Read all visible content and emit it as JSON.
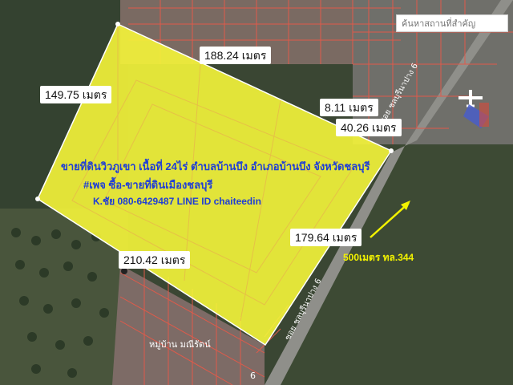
{
  "search": {
    "placeholder": "ค้นหาสถานที่สำคัญ"
  },
  "measurements": {
    "top_edge": "188.24 เมตร",
    "left_edge": "149.75 เมตร",
    "notch": "8.11 เมตร",
    "right_upper": "40.26 เมตร",
    "right_edge": "179.64 เมตร",
    "bottom_edge": "210.42 เมตร"
  },
  "listing": {
    "title": "ขายที่ดินวิวภูเขา เนื้อที่ 24ไร่ ตำบลบ้านบึง อำเภอบ้านบึง จังหวัดชลบุรี",
    "page": "#เพจ ซื้อ-ขายที่ดินเมืองชลบุรี",
    "contact": "K.ชัย 080-6429487 LINE ID chaiteedin"
  },
  "annotation": {
    "distance": "500เมตร ทล.344"
  },
  "map_labels": {
    "road_upper": "ซอย ชลบุรีนาปาง 6",
    "road_lower": "ซอย ชลบุรีนาปาง 6",
    "village": "หมู่บ้าน มณีรัตน์",
    "edge_number": "6"
  },
  "colors": {
    "plot_fill": "#f5f53a",
    "parcel_lines": "#e05a4a",
    "title_text": "#1f3ed6",
    "annotation_text": "#f2f200",
    "vegetation": "#3b4a33"
  }
}
